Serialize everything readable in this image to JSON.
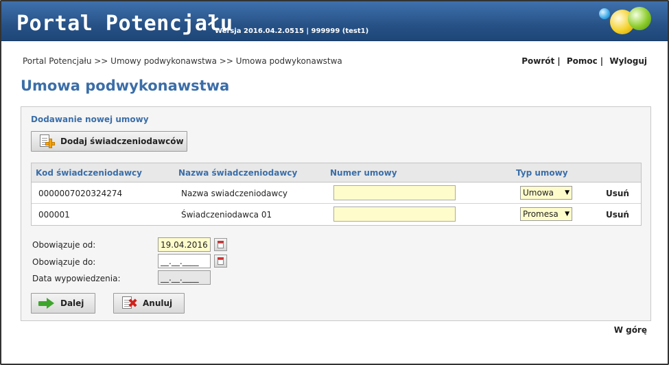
{
  "header": {
    "app_title": "Portal Potencjału",
    "version": "Wersja 2016.04.2.0515 | 999999 (test1)"
  },
  "breadcrumb": "Portal Potencjału >> Umowy podwykonawstwa >> Umowa podwykonawstwa",
  "topnav": {
    "back": "Powrót",
    "help": "Pomoc",
    "logout": "Wyloguj",
    "separator": "|"
  },
  "page_title": "Umowa podwykonawstwa",
  "form": {
    "section_title": "Dodawanie nowej umowy",
    "add_button": "Dodaj świadczeniodawców",
    "table": {
      "headers": {
        "code": "Kod świadczeniodawcy",
        "name": "Nazwa świadczeniodawcy",
        "number": "Numer umowy",
        "type": "Typ umowy"
      },
      "rows": [
        {
          "code": "0000007020324274",
          "name": "Nazwa swiadczeniodawcy",
          "number": "",
          "type": "Umowa",
          "delete": "Usuń"
        },
        {
          "code": "000001",
          "name": "Świadczeniodawca 01",
          "number": "",
          "type": "Promesa",
          "delete": "Usuń"
        }
      ]
    },
    "valid_from": {
      "label": "Obowiązuje od:",
      "value": "19.04.2016"
    },
    "valid_to": {
      "label": "Obowiązuje do:",
      "value": "__.__.____"
    },
    "termination_date": {
      "label": "Data wypowiedzenia:",
      "value": "__.__.____"
    },
    "next_button": "Dalej",
    "cancel_button": "Anuluj"
  },
  "back_to_top": "W górę",
  "colors": {
    "header_blue": "#275287",
    "title_blue": "#3b6ea8",
    "field_yellow": "#fffccc"
  }
}
